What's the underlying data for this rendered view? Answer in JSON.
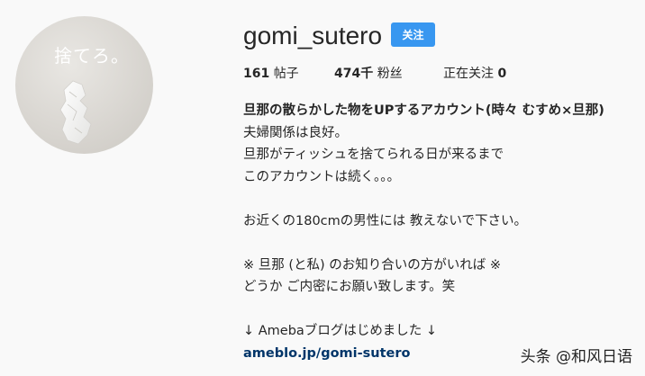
{
  "profile": {
    "avatar_text": "捨てろ。",
    "username": "gomi_sutero",
    "follow_label": "关注",
    "accent_color": "#3897f0"
  },
  "stats": {
    "posts_count": "161",
    "posts_label": "帖子",
    "followers_count": "474千",
    "followers_label": "粉丝",
    "following_label": "正在关注",
    "following_count": "0"
  },
  "bio": {
    "name": "旦那の散らかした物をUPするアカウント(時々 むすめ×旦那)",
    "lines": [
      "夫婦関係は良好。",
      "旦那がティッシュを捨てられる日が来るまで",
      "このアカウントは続く。。。",
      "",
      "お近くの180cmの男性には 教えないで下さい。",
      "",
      "※ 旦那 (と私) のお知り合いの方がいれば ※",
      "どうか ご内密にお願い致します。笑",
      "",
      "↓ Amebaブログはじめました ↓"
    ],
    "link": "ameblo.jp/gomi-sutero"
  },
  "watermark": "头条 @和风日语"
}
